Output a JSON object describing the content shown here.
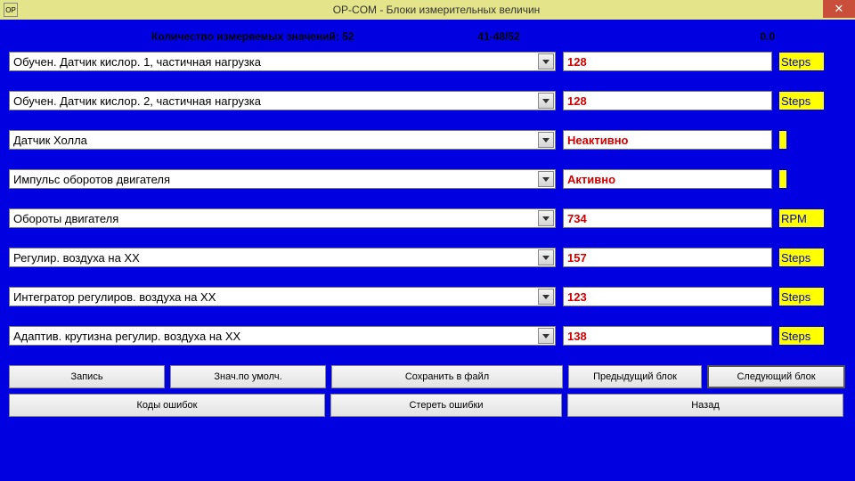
{
  "window": {
    "title": "OP-COM - Блоки измерительных величин",
    "icon_label": "OP"
  },
  "header": {
    "count_label": "Количество измеряемых значений: 52",
    "range": "41-48/52",
    "timer": "0.0"
  },
  "rows": [
    {
      "param": "Обучен. Датчик кислор. 1, частичная нагрузка",
      "value": "128",
      "unit": "Steps",
      "unit_narrow": false
    },
    {
      "param": "Обучен. Датчик кислор. 2, частичная нагрузка",
      "value": "128",
      "unit": "Steps",
      "unit_narrow": false
    },
    {
      "param": "Датчик Холла",
      "value": "Неактивно",
      "unit": "",
      "unit_narrow": true
    },
    {
      "param": "Импульс оборотов двигателя",
      "value": "Активно",
      "unit": "",
      "unit_narrow": true
    },
    {
      "param": "Обороты двигателя",
      "value": "734",
      "unit": "RPM",
      "unit_narrow": false
    },
    {
      "param": "Регулир. воздуха на ХХ",
      "value": "157",
      "unit": "Steps",
      "unit_narrow": false
    },
    {
      "param": "Интегратор регулиров. воздуха на ХХ",
      "value": "123",
      "unit": "Steps",
      "unit_narrow": false
    },
    {
      "param": "Адаптив. крутизна регулир. воздуха на ХХ",
      "value": "138",
      "unit": "Steps",
      "unit_narrow": false
    }
  ],
  "buttons": {
    "record": "Запись",
    "defaults": "Знач.по умолч.",
    "save_file": "Сохранить в файл",
    "prev_block": "Предыдущий блок",
    "next_block": "Следующий блок",
    "error_codes": "Коды ошибок",
    "clear_errors": "Стереть ошибки",
    "back": "Назад"
  }
}
